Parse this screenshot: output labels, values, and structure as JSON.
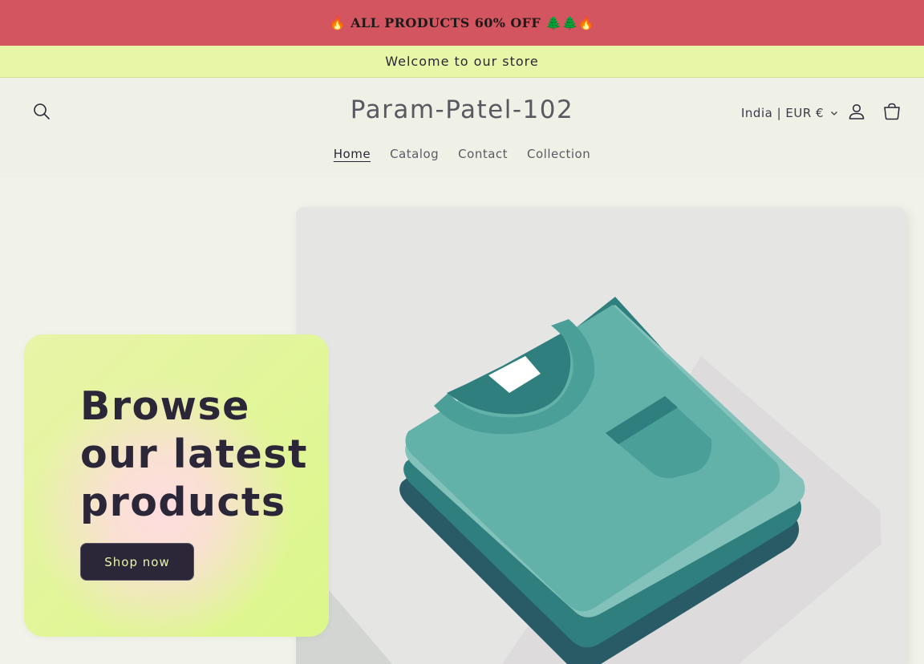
{
  "promo": {
    "text": "🔥 ALL PRODUCTS 60% OFF 🌲🌲🔥"
  },
  "announcement": {
    "text": "Welcome to our store"
  },
  "header": {
    "brand": "Param-Patel-102",
    "locale": "India | EUR €"
  },
  "nav": {
    "items": [
      {
        "label": "Home"
      },
      {
        "label": "Catalog"
      },
      {
        "label": "Contact"
      },
      {
        "label": "Collection"
      }
    ]
  },
  "hero": {
    "heading": "Browse our latest products",
    "button_label": "Shop now"
  },
  "colors": {
    "promo_bg": "#d3555f",
    "announcement_bg": "#e8f6a8",
    "page_bg": "#f1f2ea",
    "button_bg": "#2b2638",
    "shirt_light": "#63b2a9",
    "shirt_dark": "#2e7f7d"
  },
  "icons": {
    "search": "search-icon",
    "locale_chevron": "chevron-down-icon",
    "account": "account-icon",
    "cart": "cart-icon",
    "illustration": "folded-shirts-illustration"
  }
}
